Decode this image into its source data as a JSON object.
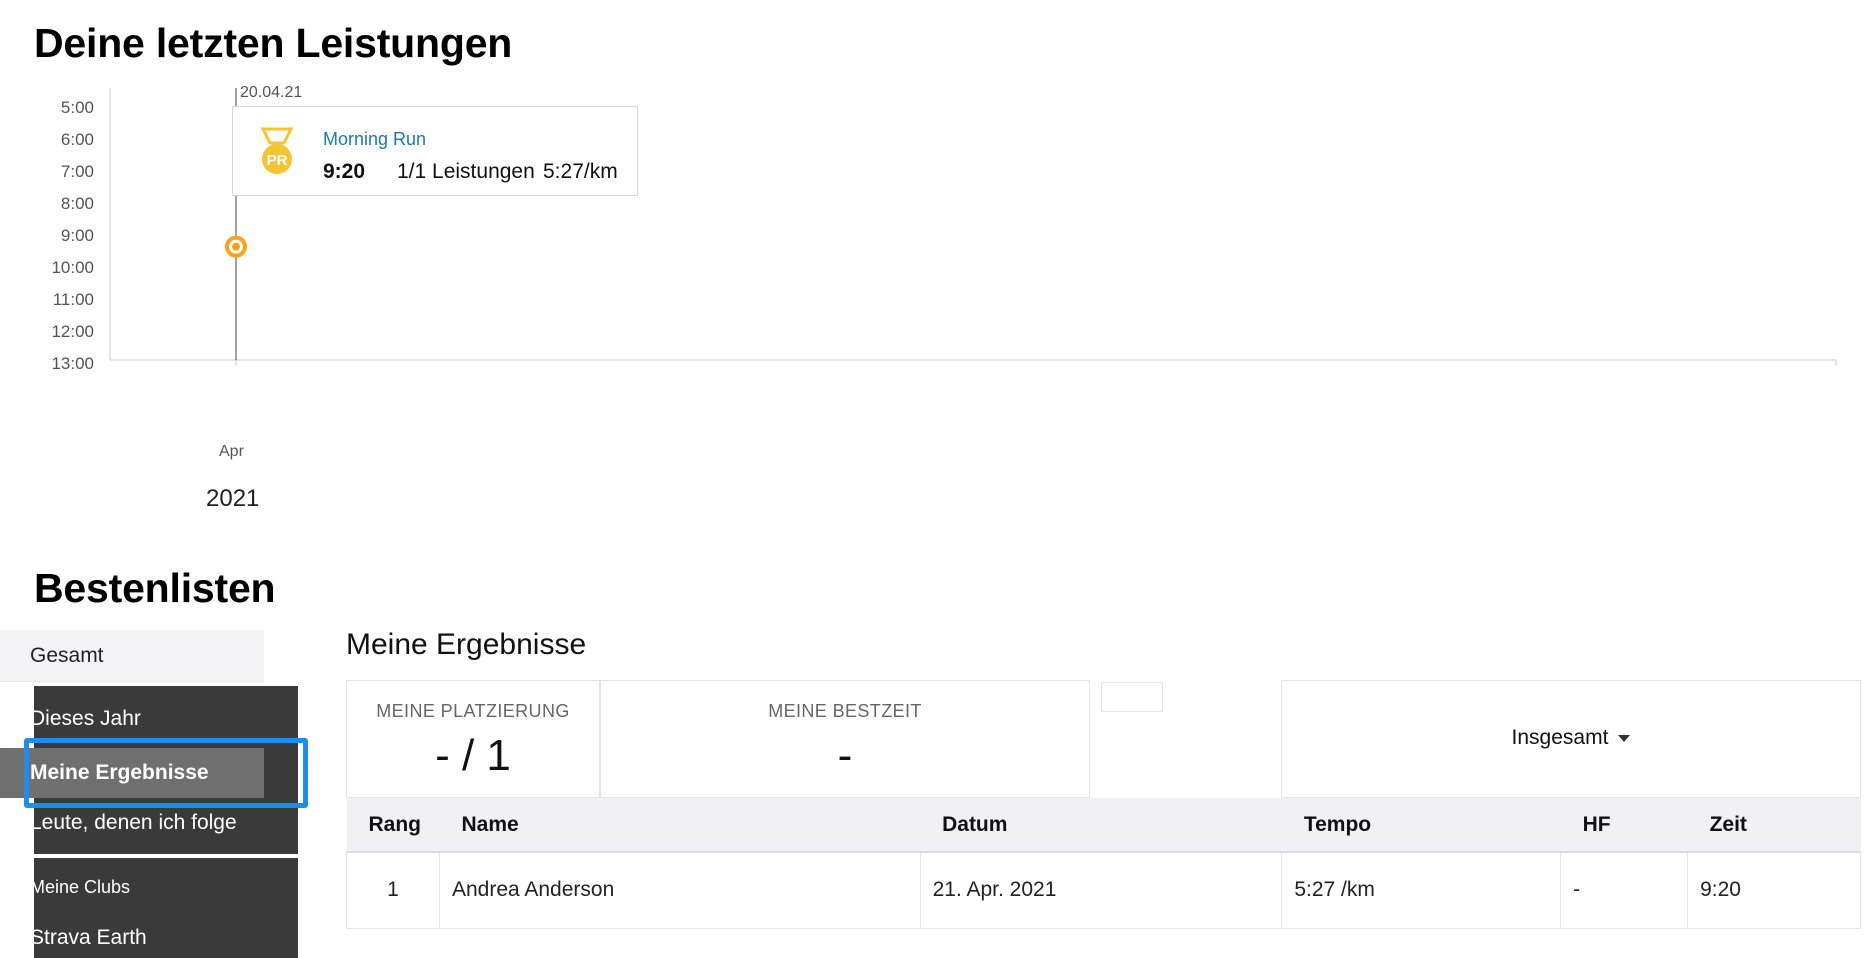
{
  "sections": {
    "recent_title": "Deine letzten Leistungen",
    "leaderboard_title": "Bestenlisten"
  },
  "chart_data": {
    "type": "scatter",
    "y_ticks": [
      "5:00",
      "6:00",
      "7:00",
      "8:00",
      "9:00",
      "10:00",
      "11:00",
      "12:00",
      "13:00"
    ],
    "x_ticks": [
      "Apr"
    ],
    "year": "2021",
    "points": [
      {
        "x": "2021-04-20",
        "y": "9:20"
      }
    ],
    "y_axis_inverted": true,
    "marker_color": "#f9a21b"
  },
  "tooltip": {
    "date": "20.04.21",
    "activity": "Morning Run",
    "time": "9:20",
    "efforts": "1/1 Leistungen",
    "pace": "5:27/km",
    "badge": "PR",
    "badge_icon": "pr-medal-icon"
  },
  "sidebar": {
    "items": [
      {
        "label": "Gesamt"
      },
      {
        "label": "Dieses Jahr"
      },
      {
        "label": "Meine Ergebnisse",
        "active": true
      },
      {
        "label": "Leute, denen ich folge"
      },
      {
        "label": "Meine Clubs"
      },
      {
        "label": "Strava Earth"
      }
    ]
  },
  "main": {
    "title": "Meine Ergebnisse",
    "stats": {
      "placement_label": "MEINE PLATZIERUNG",
      "placement_value": "- / 1",
      "best_label": "MEINE BESTZEIT",
      "best_value": "-"
    },
    "filter_label": "Insgesamt",
    "table": {
      "headers": [
        "Rang",
        "Name",
        "Datum",
        "Tempo",
        "HF",
        "Zeit"
      ],
      "rows": [
        {
          "rank": "1",
          "name": "Andrea Anderson",
          "date": "21. Apr. 2021",
          "pace": "5:27 /km",
          "hr": "-",
          "time": "9:20"
        }
      ]
    }
  },
  "colors": {
    "accent": "#1b7ba8",
    "marker": "#f9a21b",
    "sidebar_dark": "#3a3a3a",
    "focus": "#1e8cf0"
  }
}
